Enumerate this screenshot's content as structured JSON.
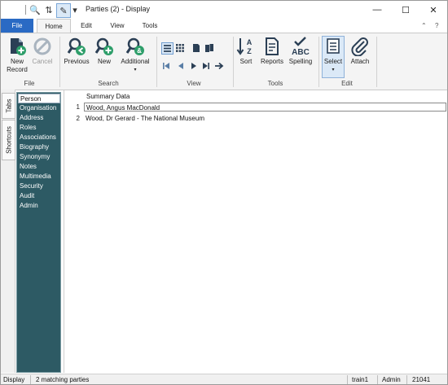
{
  "window": {
    "title": "Parties (2) - Display",
    "controls": {
      "minimize": "—",
      "maximize": "☐",
      "close": "✕"
    }
  },
  "quick_access": {
    "search_icon": "🔍",
    "sort_icon": "⇅",
    "edit_icon": "✎",
    "dropdown_icon": "▾"
  },
  "ribbon_tabs": {
    "file": "File",
    "home": "Home",
    "edit": "Edit",
    "view": "View",
    "tools": "Tools"
  },
  "ribbon_right": {
    "collapse": "⌃",
    "help": "?"
  },
  "ribbon": {
    "file_group": {
      "label": "File",
      "new_record": "New Record",
      "cancel": "Cancel"
    },
    "search_group": {
      "label": "Search",
      "previous": "Previous",
      "new": "New",
      "additional": "Additional"
    },
    "view_group": {
      "label": "View"
    },
    "tools_group": {
      "label": "Tools",
      "sort": "Sort",
      "reports": "Reports",
      "spelling": "Spelling"
    },
    "edit_group": {
      "label": "Edit",
      "select": "Select",
      "attach": "Attach"
    }
  },
  "rail": {
    "tabs": "Tabs",
    "shortcuts": "Shortcuts"
  },
  "tab_list": [
    "Person",
    "Organisation",
    "Address",
    "Roles",
    "Associations",
    "Biography",
    "Synonymy",
    "Notes",
    "Multimedia",
    "Security",
    "Audit",
    "Admin"
  ],
  "grid": {
    "header": "Summary Data",
    "rows": [
      {
        "num": "1",
        "text": "Wood, Angus MacDonald"
      },
      {
        "num": "2",
        "text": "Wood, Dr Gerard - The National Museum"
      }
    ]
  },
  "status_bar": {
    "mode": "Display",
    "matches": "2 matching parties",
    "user": "train1",
    "role": "Admin",
    "id": "21041"
  },
  "colors": {
    "accent": "#2a6ac4",
    "search_green": "#2e9e6a",
    "tab_panel": "#2d5a64",
    "icon_dark": "#2b3f55"
  }
}
